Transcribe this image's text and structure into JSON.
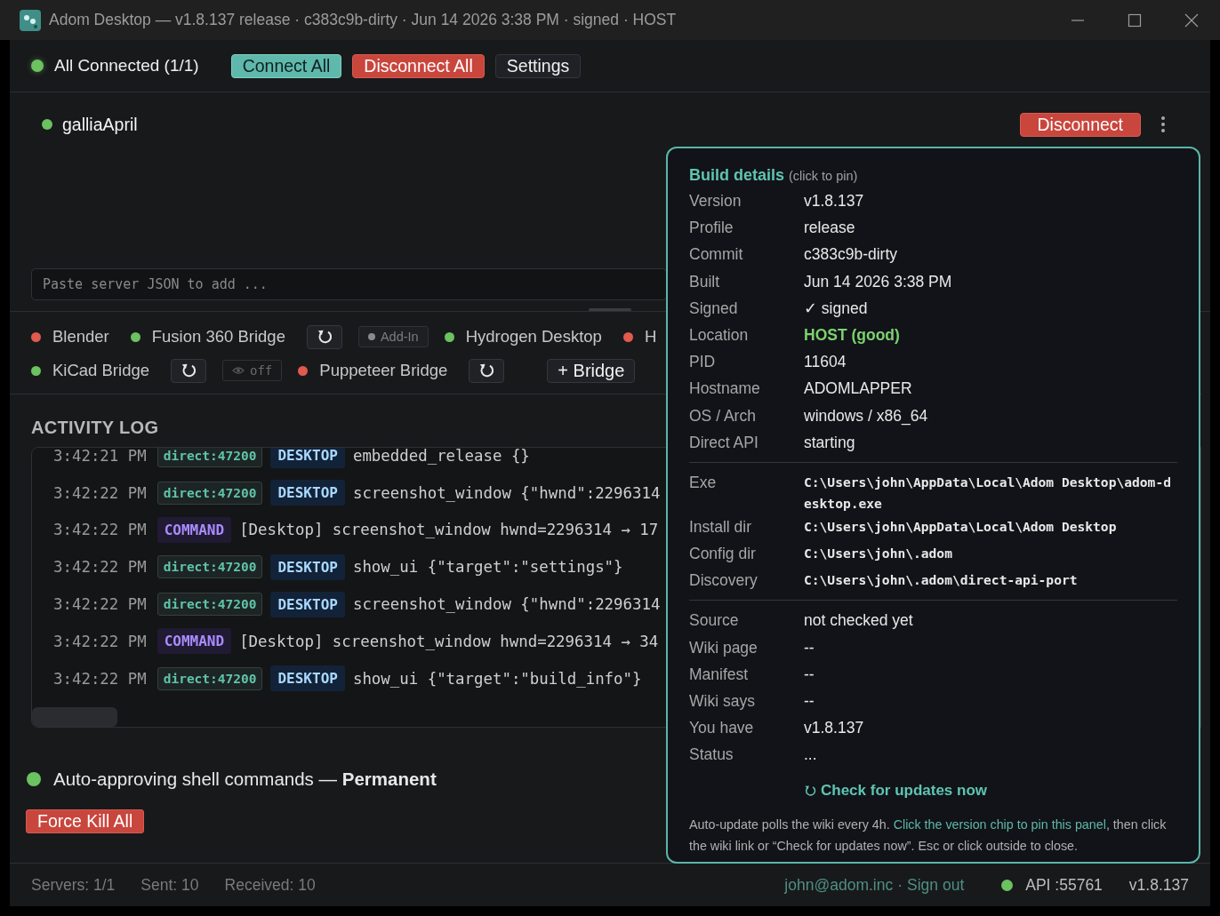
{
  "window": {
    "title": "Adom Desktop — v1.8.137 release · c383c9b-dirty · Jun 14 2026 3:38 PM · signed · HOST"
  },
  "toolbar": {
    "status": "All Connected (1/1)",
    "connected": true,
    "buttons": [
      {
        "label": "Connect All",
        "kind": "primary"
      },
      {
        "label": "Disconnect All",
        "kind": "danger"
      },
      {
        "label": "Settings",
        "kind": "plain"
      }
    ]
  },
  "server": {
    "name": "galliaApril",
    "connected": true,
    "action": "Disconnect"
  },
  "paste_field": {
    "placeholder": "Paste server JSON to add ..."
  },
  "bridge_rows": [
    {
      "items": [
        {
          "kind": "bridge",
          "label": "Blender",
          "color": "#e05a4e"
        },
        {
          "kind": "bridge",
          "label": "Fusion 360 Bridge",
          "color": "#6cc160"
        },
        {
          "kind": "refresh"
        },
        {
          "kind": "addin",
          "label": "Add-In"
        },
        {
          "kind": "bridge",
          "label": "Hydrogen Desktop",
          "color": "#6cc160"
        },
        {
          "kind": "bridge",
          "label": "H",
          "color": "#e05a4e"
        }
      ]
    },
    {
      "items": [
        {
          "kind": "bridge",
          "label": "KiCad Bridge",
          "color": "#6cc160"
        },
        {
          "kind": "refresh"
        },
        {
          "kind": "visibility",
          "label": "off"
        },
        {
          "kind": "bridge",
          "label": "Puppeteer Bridge",
          "color": "#e05a4e"
        },
        {
          "kind": "refresh"
        },
        {
          "kind": "add",
          "label": "+ Bridge"
        }
      ]
    }
  ],
  "activity_log": {
    "title": "ACTIVITY LOG",
    "entries": [
      {
        "kind": "direct",
        "time": "3:42:21 PM",
        "source": "direct:47200",
        "tag": "DESKTOP",
        "message": "embedded_release {}"
      },
      {
        "kind": "direct",
        "time": "3:42:22 PM",
        "source": "direct:47200",
        "tag": "DESKTOP",
        "message": "screenshot_window {\"hwnd\":2296314"
      },
      {
        "kind": "command",
        "time": "3:42:22 PM",
        "tag": "COMMAND",
        "message": "[Desktop] screenshot_window hwnd=2296314 → 17"
      },
      {
        "kind": "direct",
        "time": "3:42:22 PM",
        "source": "direct:47200",
        "tag": "DESKTOP",
        "message": "show_ui {\"target\":\"settings\"}"
      },
      {
        "kind": "direct",
        "time": "3:42:22 PM",
        "source": "direct:47200",
        "tag": "DESKTOP",
        "message": "screenshot_window {\"hwnd\":2296314"
      },
      {
        "kind": "command",
        "time": "3:42:22 PM",
        "tag": "COMMAND",
        "message": "[Desktop] screenshot_window hwnd=2296314 → 34"
      },
      {
        "kind": "direct",
        "time": "3:42:22 PM",
        "source": "direct:47200",
        "tag": "DESKTOP",
        "message": "show_ui {\"target\":\"build_info\"}"
      }
    ]
  },
  "auto_approve": {
    "on": true,
    "text": "Auto-approving shell commands — **Permanent**"
  },
  "force_kill": "Force Kill All",
  "build_details": {
    "title": "Build details",
    "hint": "(click to pin)",
    "groups": [
      [
        {
          "label": "Version",
          "value": "v1.8.137"
        },
        {
          "label": "Profile",
          "value": "release"
        },
        {
          "label": "Commit",
          "value": "c383c9b-dirty"
        },
        {
          "label": "Built",
          "value": "Jun 14 2026 3:38 PM"
        },
        {
          "label": "Signed",
          "value": "✓ signed"
        },
        {
          "label": "Location",
          "value": "HOST (good)",
          "kind": "good"
        },
        {
          "label": "PID",
          "value": "11604"
        },
        {
          "label": "Hostname",
          "value": "ADOMLAPPER"
        },
        {
          "label": "OS / Arch",
          "value": "windows / x86_64"
        },
        {
          "label": "Direct API",
          "value": "starting"
        }
      ],
      [
        {
          "label": "Exe",
          "value": "C:\\Users\\john\\AppData\\Local\\Adom Desktop\\adom-desktop.exe",
          "kind": "path"
        },
        {
          "label": "Install dir",
          "value": "C:\\Users\\john\\AppData\\Local\\Adom Desktop",
          "kind": "path"
        },
        {
          "label": "Config dir",
          "value": "C:\\Users\\john\\.adom",
          "kind": "path"
        },
        {
          "label": "Discovery",
          "value": "C:\\Users\\john\\.adom\\direct-api-port",
          "kind": "path"
        }
      ],
      [
        {
          "label": "Source",
          "value": "not checked yet"
        },
        {
          "label": "Wiki page",
          "value": "--"
        },
        {
          "label": "Manifest",
          "value": "--"
        },
        {
          "label": "Wiki says",
          "value": "--"
        },
        {
          "label": "You have",
          "value": "v1.8.137"
        },
        {
          "label": "Status",
          "value": "..."
        }
      ]
    ],
    "check_link": "Check for updates now",
    "note": {
      "before": "Auto-update polls the wiki every 4h. ",
      "link": "Click the version chip to pin this panel",
      "after": ", then click the wiki link or “Check for updates now”. Esc or click outside to close."
    }
  },
  "status_bar": {
    "counters": [
      "Servers: 1/1",
      "Sent: 10",
      "Received: 10"
    ],
    "email": "john@adom.inc",
    "separator": "·",
    "sign_out": "Sign out",
    "api": "API :55761",
    "api_connected": true,
    "version": "v1.8.137"
  }
}
